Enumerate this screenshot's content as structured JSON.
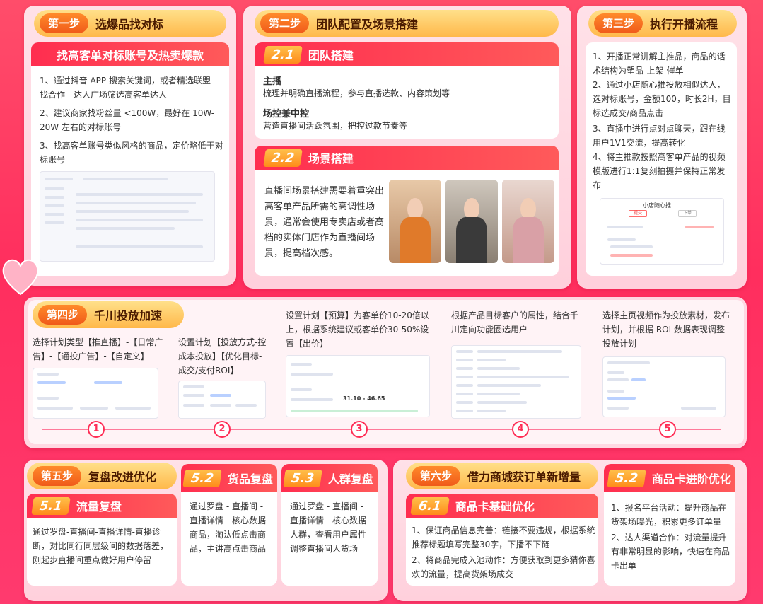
{
  "step1": {
    "badge": "第一步",
    "title": "选爆品找对标",
    "bar": "找高客单对标账号及热卖爆款",
    "items": [
      "1、通过抖音 APP 搜索关键词，或者精选联盟 - 找合作 - 达人广场筛选高客单达人",
      "2、建议商家找粉丝量 <100W，最好在 10W-20W 左右的对标账号",
      "3、找高客单账号类似风格的商品，定价略低于对标账号"
    ]
  },
  "step2": {
    "badge": "第二步",
    "title": "团队配置及场景搭建",
    "sub1": {
      "num": "2.1",
      "title": "团队搭建",
      "h1": "主播",
      "p1": "梳理并明确直播流程，参与直播选款、内容策划等",
      "h2": "场控兼中控",
      "p2": "营造直播间活跃氛围，把控过款节奏等"
    },
    "sub2": {
      "num": "2.2",
      "title": "场景搭建",
      "p": "直播间场景搭建需要着重突出高客单产品所需的高调性场景，通常会使用专卖店或者高档的实体门店作为直播间场景，提高档次感。"
    }
  },
  "step3": {
    "badge": "第三步",
    "title": "执行开播流程",
    "items": [
      "1、开播正常讲解主推品，商品的话术结构为塑品-上架-催单",
      "2、通过小店随心推投放相似达人，选对标账号，金额100，时长2H，目标选成交/商品点击",
      "3、直播中进行点对点聊天，跟在线用户1V1交流，提高转化",
      "4、将主推款按照高客单产品的视频模版进行1:1复刻拍摄并保持正常发布"
    ],
    "shot_title": "小店随心推",
    "shot_tabs": [
      "提交",
      "",
      "下单",
      ""
    ]
  },
  "step4": {
    "badge": "第四步",
    "title": "千川投放加速",
    "cols": [
      "选择计划类型【推直播】-【日常广告】-【通投广告】-【自定义】",
      "设置计划【投放方式-控成本投放】【优化目标-成交/支付ROI】",
      "设置计划【预算】为客单价10-20倍以上，根据系统建议或客单价30-50%设置【出价】",
      "根据产品目标客户的属性，结合千川定向功能圈选用户",
      "选择主页视频作为投放素材，发布计划，并根据 ROI 数据表现调整投放计划"
    ],
    "nums": [
      "1",
      "2",
      "3",
      "4",
      "5"
    ],
    "bid_hint": "31.10 - 46.65"
  },
  "step5": {
    "badge": "第五步",
    "title": "复盘改进优化",
    "s1": {
      "num": "5.1",
      "title": "流量复盘",
      "p": "通过罗盘-直播间-直播详情-直播诊断，对比同行同层级间的数据落差，刚起步直播间重点做好用户停留"
    },
    "s2": {
      "num": "5.2",
      "title": "货品复盘",
      "p": "通过罗盘 - 直播间 - 直播详情 - 核心数据 - 商品，淘汰低点击商品，主讲高点击商品"
    },
    "s3": {
      "num": "5.3",
      "title": "人群复盘",
      "p": "通过罗盘 - 直播间 - 直播详情 - 核心数据 - 人群，查看用户属性调整直播间人货场"
    }
  },
  "step6": {
    "badge": "第六步",
    "title": "借力商城获订单新增量",
    "s1": {
      "num": "6.1",
      "title": "商品卡基础优化",
      "items": [
        "1、保证商品信息完善：链接不要违规，根据系统推荐标题填写完整30字，下播不下链",
        "2、将商品完成入池动作：方便获取到更多猜你喜欢的流量，提高货架场成交"
      ]
    },
    "s2": {
      "num": "5.2",
      "title": "商品卡进阶优化",
      "items": [
        "1、报名平台活动：提升商品在货架场曝光，积累更多订单量",
        "2、达人渠道合作：对流量提升有非常明显的影响，快速在商品卡出单"
      ]
    }
  }
}
